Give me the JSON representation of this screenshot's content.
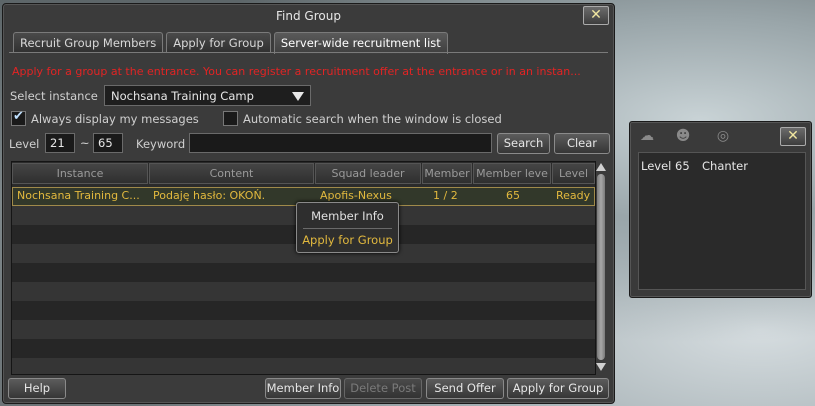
{
  "window": {
    "title": "Find Group",
    "close_label": "✕",
    "tabs": [
      {
        "label": "Recruit Group Members"
      },
      {
        "label": "Apply for Group"
      },
      {
        "label": "Server-wide recruitment list"
      }
    ],
    "notice": "Apply for a group at the entrance. You can register a recruitment offer at the entrance or in an instan...",
    "select_instance_label": "Select instance",
    "instance_value": "Nochsana Training Camp",
    "always_display_label": "Always display my messages",
    "always_display_checked": true,
    "auto_search_label": "Automatic search when the window is closed",
    "auto_search_checked": false,
    "level_label": "Level",
    "level_min": "21",
    "level_sep": "~",
    "level_max": "65",
    "keyword_label": "Keyword",
    "keyword_value": "",
    "search_label": "Search",
    "clear_label": "Clear"
  },
  "list": {
    "columns": [
      "Instance",
      "Content",
      "Squad leader",
      "Member",
      "Member leve",
      "Level"
    ],
    "rows": [
      {
        "instance": "Nochsana Training C...",
        "content": "Podaję hasło: OKOŃ.",
        "leader": "Apofis-Nexus",
        "members": "1 / 2",
        "member_level": "65",
        "status": "Ready"
      }
    ]
  },
  "context_menu": {
    "items": [
      {
        "label": "Member Info"
      },
      {
        "label": "Apply for Group"
      }
    ]
  },
  "footer": {
    "help_label": "Help",
    "member_info_label": "Member Info",
    "delete_post_label": "Delete Post",
    "send_offer_label": "Send Offer",
    "apply_label": "Apply for Group"
  },
  "side_panel": {
    "level_text": "Level 65",
    "class_text": "Chanter",
    "close_label": "✕"
  },
  "colors": {
    "notice": "#e22424",
    "row_text": "#e2b93e",
    "ctx_active": "#e2b93e"
  }
}
